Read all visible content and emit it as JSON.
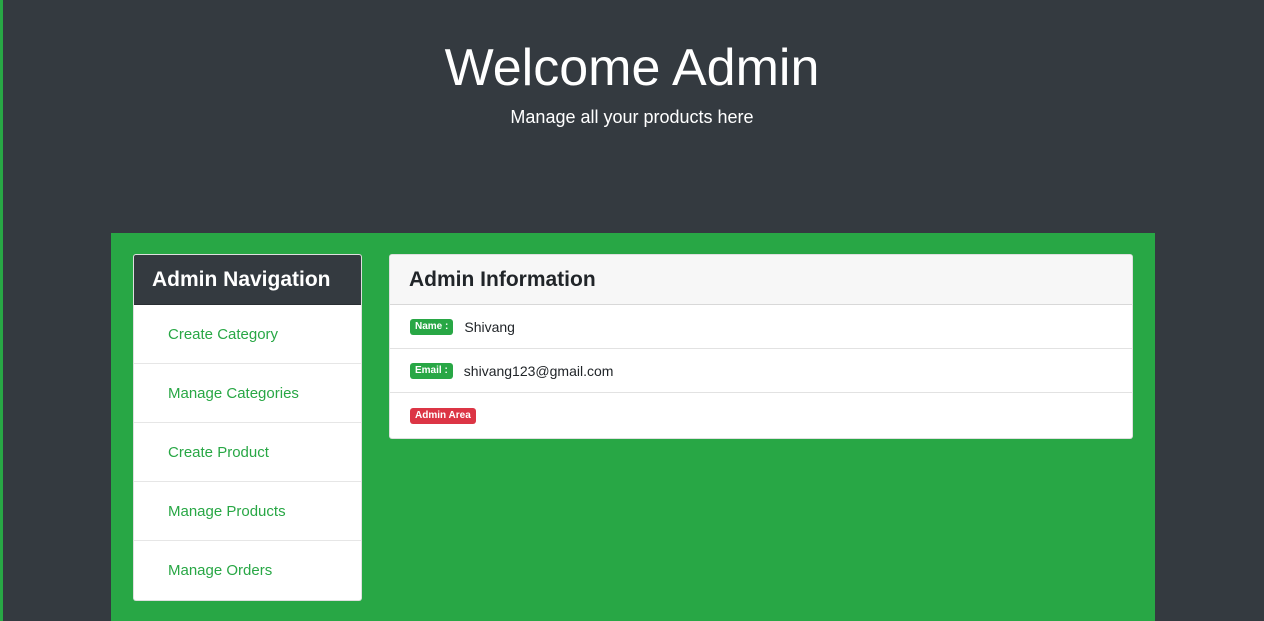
{
  "hero": {
    "title": "Welcome Admin",
    "subtitle": "Manage all your products here"
  },
  "navigation": {
    "header": "Admin Navigation",
    "items": [
      {
        "label": "Create Category"
      },
      {
        "label": "Manage Categories"
      },
      {
        "label": "Create Product"
      },
      {
        "label": "Manage Products"
      },
      {
        "label": "Manage Orders"
      }
    ]
  },
  "admin_info": {
    "header": "Admin Information",
    "name_badge": "Name :",
    "name_value": "Shivang",
    "email_badge": "Email :",
    "email_value": "shivang123@gmail.com",
    "area_badge": "Admin Area"
  },
  "colors": {
    "background": "#343a40",
    "accent_green": "#28a745",
    "danger_red": "#dc3545"
  }
}
